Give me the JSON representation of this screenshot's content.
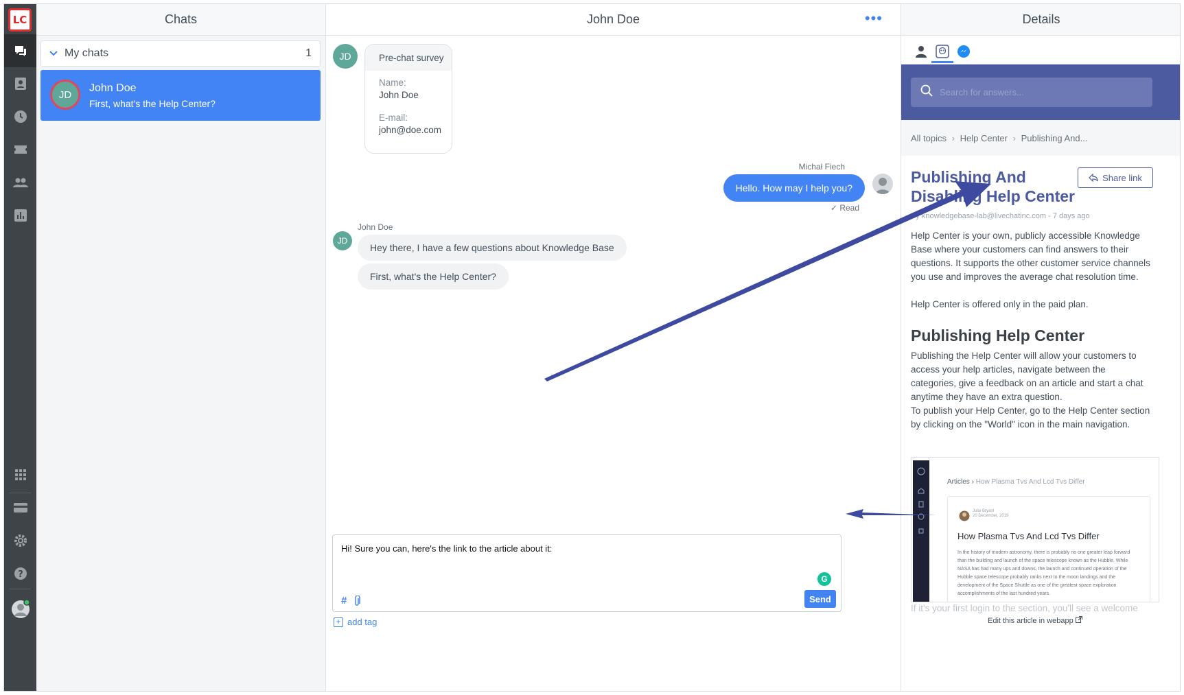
{
  "app": {
    "logo_text": "LC"
  },
  "rail": {
    "icons": [
      "chats-icon",
      "contacts-icon",
      "history-icon",
      "tickets-icon",
      "team-icon",
      "reports-icon",
      "apps-icon",
      "billing-icon",
      "settings-icon",
      "help-icon",
      "profile-icon"
    ]
  },
  "chats": {
    "header": "Chats",
    "group_label": "My chats",
    "group_count": "1",
    "items": [
      {
        "initials": "JD",
        "name": "John Doe",
        "preview": "First, what's the Help Center?"
      }
    ]
  },
  "conversation": {
    "header": "John Doe",
    "more_label": "•••",
    "survey": {
      "title": "Pre-chat survey",
      "name_label": "Name:",
      "name_value": "John Doe",
      "email_label": "E-mail:",
      "email_value": "john@doe.com"
    },
    "visitor_initials": "JD",
    "agent_name": "Michał Fiech",
    "agent_message": "Hello. How may I help you?",
    "read_status": "Read",
    "visitor_name": "John Doe",
    "visitor_messages": [
      "Hey there, I have a few questions about Knowledge Base",
      "First, what's the Help Center?"
    ],
    "composer_text": "Hi! Sure you can, here's the link to the article about it:",
    "send_label": "Send",
    "hash_label": "#",
    "add_tag_label": "add tag"
  },
  "details": {
    "header": "Details",
    "search_placeholder": "Search for answers...",
    "breadcrumbs": [
      "All topics",
      "Help Center",
      "Publishing And..."
    ],
    "title": "Publishing And Disabling Help Center",
    "share_label": "Share link",
    "meta": "By knowledgebase-lab@livechatinc.com - 7 days ago",
    "para1": "Help Center is your own, publicly accessible Knowledge Base where your customers can find answers to their questions. It supports the other customer service channels you use and improves the average chat resolution time.",
    "para2": "Help Center is offered only in the paid plan.",
    "heading2": "Publishing Help Center",
    "para3": "Publishing the Help Center will allow your customers to access your help articles, navigate between the categories, give a feedback on an article and start a chat anytime they have an extra question.",
    "para4": "To publish your Help Center, go to the Help Center section by clicking on the \"World\" icon in the main navigation.",
    "image": {
      "crumb_root": "Articles",
      "crumb_leaf": "How Plasma Tvs And Lcd Tvs Differ",
      "author": "Julia Bryant",
      "date": "20 December, 2019",
      "card_title": "How Plasma Tvs And Lcd Tvs Differ",
      "card_body": "In the history of modern astronomy, there is probably no one greater leap forward than the building and launch of the space telescope known as the Hubble. While NASA has had many ups and downs, the launch and continued operation of the Hubble space telescope probably ranks next to the moon landings and the development of the Space Shuttle as one of the greatest space exploration accomplishments of the last hundred years."
    },
    "faded_text": "If it's your first login to the section, you'll see a welcome",
    "edit_label": "Edit this article in webapp"
  },
  "colors": {
    "accent": "#4384f5",
    "kb_brand": "#4c5b9f",
    "rail_bg": "#3f4448",
    "avatar": "#5fa899",
    "arrow": "#3d4aa0"
  }
}
